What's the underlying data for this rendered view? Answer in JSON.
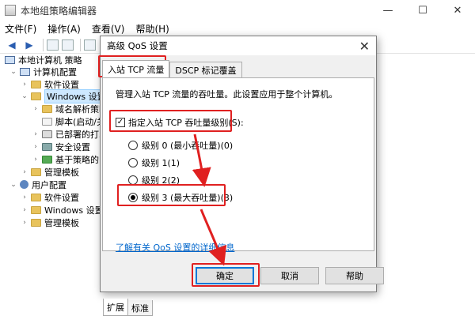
{
  "main_window": {
    "title": "本地组策略编辑器",
    "controls": {
      "minimize": "—",
      "maximize": "☐",
      "close": "✕"
    },
    "menu": [
      "文件(F)",
      "操作(A)",
      "查看(V)",
      "帮助(H)"
    ],
    "tree": {
      "root": "本地计算机 策略",
      "computer_config": "计算机配置",
      "software_settings": "软件设置",
      "windows_settings": "Windows 设置",
      "dns": "域名解析策略",
      "scripts": "脚本(启动/关",
      "printers": "已部署的打印",
      "security": "安全设置",
      "qos": "基于策略的 C",
      "admin_templates": "管理模板",
      "user_config": "用户配置",
      "user_software": "软件设置",
      "user_windows": "Windows 设置",
      "user_admin": "管理模板"
    },
    "status_tabs": [
      "扩展",
      "标准"
    ]
  },
  "dialog": {
    "title": "高级 QoS 设置",
    "close": "✕",
    "tabs": [
      "入站 TCP 流量",
      "DSCP 标记覆盖"
    ],
    "description": "管理入站 TCP 流量的吞吐量。此设置应用于整个计算机。",
    "checkbox_label": "指定入站 TCP 吞吐量级别(S):",
    "checkbox_checked": true,
    "levels": [
      {
        "label": "级别 0 (最小吞吐量)(0)",
        "selected": false
      },
      {
        "label": "级别 1(1)",
        "selected": false
      },
      {
        "label": "级别 2(2)",
        "selected": false
      },
      {
        "label": "级别 3 (最大吞吐量)(3)",
        "selected": true
      }
    ],
    "link": "了解有关 QoS 设置的详细信息",
    "buttons": {
      "ok": "确定",
      "cancel": "取消",
      "help": "帮助"
    }
  },
  "colors": {
    "highlight": "#e02020",
    "accent": "#0078d7",
    "link": "#0066cc"
  }
}
